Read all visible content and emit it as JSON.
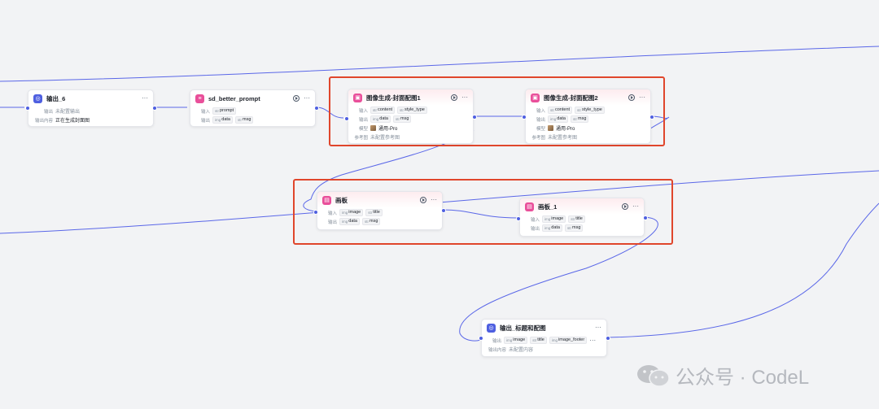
{
  "nodes": {
    "output6": {
      "title": "输出_6",
      "rows": [
        {
          "label": "输出",
          "value": "未配置输出"
        },
        {
          "label": "输出内容",
          "value": "正在生成封面图"
        }
      ]
    },
    "sd_prompt": {
      "title": "sd_better_prompt",
      "input_label": "输入",
      "inputs": [
        {
          "type": "str",
          "name": "prompt"
        }
      ],
      "output_label": "输出",
      "outputs": [
        {
          "type": "img",
          "name": "data"
        },
        {
          "type": "str",
          "name": "msg"
        }
      ]
    },
    "gen1": {
      "title": "图像生成-封面配图1",
      "input_label": "输入",
      "inputs": [
        {
          "type": "str",
          "name": "content"
        },
        {
          "type": "str",
          "name": "style_type"
        }
      ],
      "output_label": "输出",
      "outputs": [
        {
          "type": "img",
          "name": "data"
        },
        {
          "type": "str",
          "name": "msg"
        }
      ],
      "model_label": "模型",
      "model_value": "通用-Pro",
      "ref_label": "参考图",
      "ref_value": "未配置参考图"
    },
    "gen2": {
      "title": "图像生成-封面配图2",
      "input_label": "输入",
      "inputs": [
        {
          "type": "str",
          "name": "content"
        },
        {
          "type": "str",
          "name": "style_type"
        }
      ],
      "output_label": "输出",
      "outputs": [
        {
          "type": "img",
          "name": "data"
        },
        {
          "type": "str",
          "name": "msg"
        }
      ],
      "model_label": "模型",
      "model_value": "通用-Pro",
      "ref_label": "参考图",
      "ref_value": "未配置参考图"
    },
    "board": {
      "title": "画板",
      "input_label": "输入",
      "inputs": [
        {
          "type": "img",
          "name": "image"
        },
        {
          "type": "str",
          "name": "title"
        }
      ],
      "output_label": "输出",
      "outputs": [
        {
          "type": "img",
          "name": "data"
        },
        {
          "type": "str",
          "name": "msg"
        }
      ]
    },
    "board1": {
      "title": "画板_1",
      "input_label": "输入",
      "inputs": [
        {
          "type": "img",
          "name": "image"
        },
        {
          "type": "str",
          "name": "title"
        }
      ],
      "output_label": "输出",
      "outputs": [
        {
          "type": "img",
          "name": "data"
        },
        {
          "type": "str",
          "name": "msg"
        }
      ]
    },
    "final": {
      "title": "输出_标题和配图",
      "output_label": "输出",
      "outputs": [
        {
          "type": "img",
          "name": "image"
        },
        {
          "type": "str",
          "name": "title"
        },
        {
          "type": "img",
          "name": "image_footer"
        }
      ],
      "content_label": "输出内容",
      "content_value": "未配置内容"
    }
  },
  "more_glyph": "···",
  "watermark": {
    "text": "公众号 · CodeL"
  },
  "colors": {
    "edge": "#4e5fe0",
    "highlight": "#e0462c",
    "canvas": "#f2f3f5"
  }
}
